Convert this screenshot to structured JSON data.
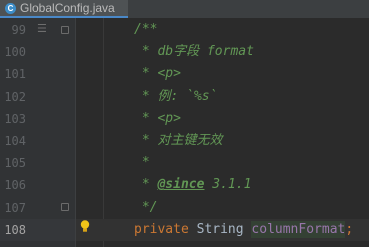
{
  "tab": {
    "label": "GlobalConfig.java",
    "icon": "java-class-icon",
    "icon_letter": "C"
  },
  "lines": [
    {
      "num": "99",
      "tokens": [
        {
          "t": "/**",
          "c": "c-doc"
        }
      ]
    },
    {
      "num": "100",
      "tokens": [
        {
          "t": " * db字段 format",
          "c": "c-doc"
        }
      ]
    },
    {
      "num": "101",
      "tokens": [
        {
          "t": " * <p>",
          "c": "c-doc"
        }
      ]
    },
    {
      "num": "102",
      "tokens": [
        {
          "t": " * 例: `%s`",
          "c": "c-doc"
        }
      ]
    },
    {
      "num": "103",
      "tokens": [
        {
          "t": " * <p>",
          "c": "c-doc"
        }
      ]
    },
    {
      "num": "104",
      "tokens": [
        {
          "t": " * 对主键无效",
          "c": "c-doc"
        }
      ]
    },
    {
      "num": "105",
      "tokens": [
        {
          "t": " *",
          "c": "c-doc"
        }
      ]
    },
    {
      "num": "106",
      "tokens": [
        {
          "t": " * ",
          "c": "c-doc"
        },
        {
          "t": "@since",
          "c": "c-tag"
        },
        {
          "t": " 3.1.1",
          "c": "c-doc"
        }
      ]
    },
    {
      "num": "107",
      "tokens": [
        {
          "t": " */",
          "c": "c-doc"
        }
      ]
    },
    {
      "num": "108",
      "current": true,
      "tokens": [
        {
          "t": "private ",
          "c": "c-kw"
        },
        {
          "t": "String ",
          "c": "c-type"
        },
        {
          "t": "columnFormat",
          "c": "c-field hl-field"
        },
        {
          "t": ";",
          "c": "c-punct"
        }
      ]
    }
  ],
  "gutter_icons": {
    "line99": "implementation-list-icon",
    "line108": "intention-bulb-icon"
  },
  "colors": {
    "background": "#2b2b2b",
    "doc_comment": "#629755",
    "keyword": "#cc7832",
    "field": "#9876aa"
  }
}
